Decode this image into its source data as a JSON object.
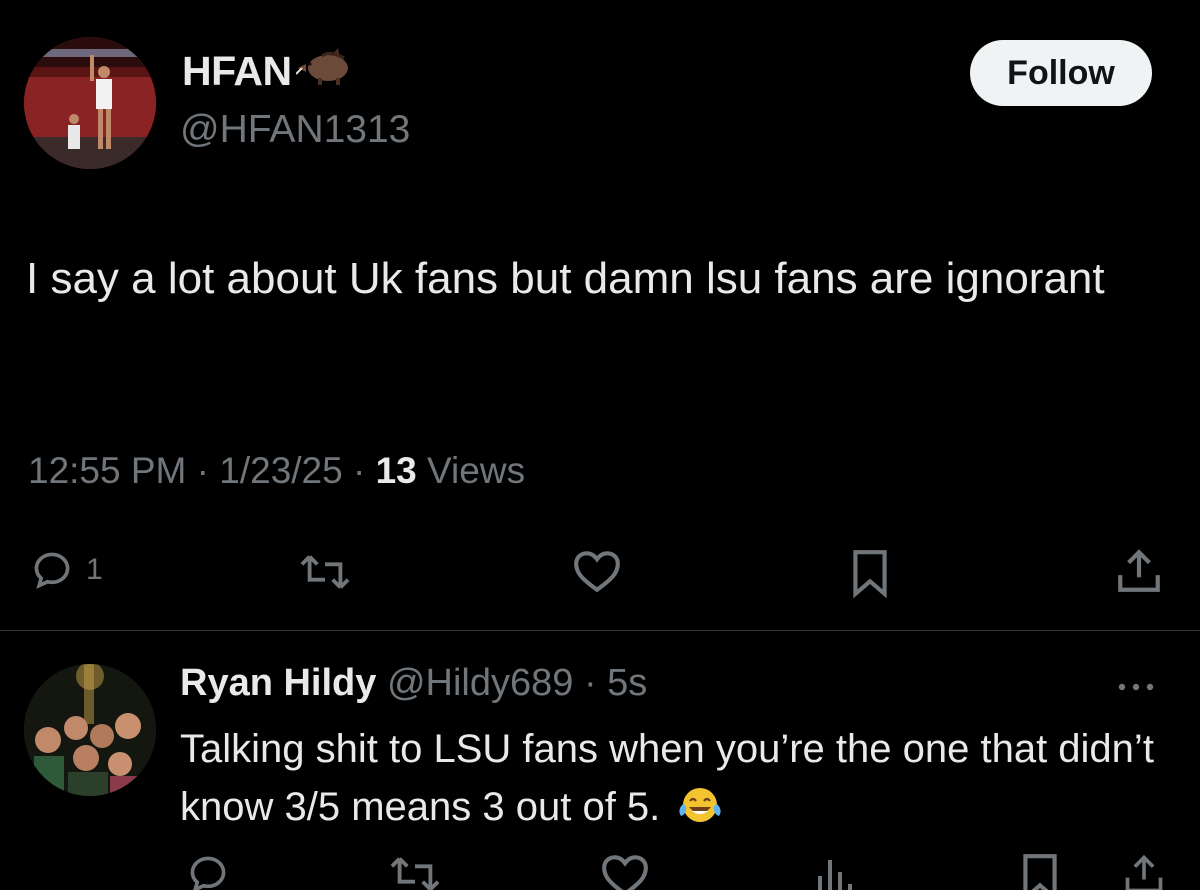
{
  "tweet": {
    "author": {
      "name": "HFAN",
      "name_emoji_icon": "boar-icon",
      "handle": "@HFAN1313"
    },
    "follow_label": "Follow",
    "text": "I say a lot about Uk fans but damn lsu fans are ignorant",
    "meta": {
      "time": "12:55 PM",
      "sep1": "·",
      "date": "1/23/25",
      "sep2": "·",
      "views_count": "13",
      "views_label": "Views"
    },
    "actions": {
      "reply_count": "1",
      "icons": [
        "reply-icon",
        "retweet-icon",
        "like-icon",
        "bookmark-icon",
        "share-icon"
      ]
    }
  },
  "reply": {
    "name": "Ryan Hildy",
    "handle": "@Hildy689",
    "dot": "·",
    "time": "5s",
    "text": "Talking shit to LSU fans when you’re the one that didn’t know 3/5 means 3 out of 5.",
    "emoji_icon": "tears-of-joy-icon",
    "icons": [
      "reply-icon",
      "retweet-icon",
      "like-icon",
      "views-icon",
      "bookmark-icon",
      "share-icon",
      "more-icon"
    ]
  },
  "colors": {
    "background": "#000000",
    "primary_text": "#e7e9ea",
    "secondary_text": "#71767b",
    "divider": "#2f3336",
    "follow_button": "#eff3f4"
  }
}
